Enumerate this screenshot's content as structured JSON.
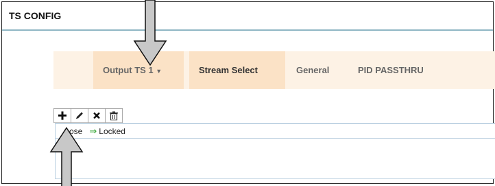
{
  "panel": {
    "title": "TS CONFIG"
  },
  "tabs": [
    {
      "label": "Output TS 1",
      "caret": "▼"
    },
    {
      "label": "Stream Select"
    },
    {
      "label": "General"
    },
    {
      "label": "PID PASSTHRU"
    }
  ],
  "toolbar": {
    "add_icon": "plus-icon",
    "edit_icon": "pencil-icon",
    "remove_icon": "x-icon",
    "delete_icon": "trash-icon"
  },
  "legend": {
    "close_label": "ose",
    "locked_arrow": "⇒",
    "locked_label": "Locked"
  },
  "colors": {
    "tabbar_bg": "#fdf2e5",
    "tab_active_bg": "#fbe2c6",
    "header_border": "#8fb6c4",
    "locked_arrow": "#31a331",
    "annotation_arrow": "#c8c8c8"
  }
}
